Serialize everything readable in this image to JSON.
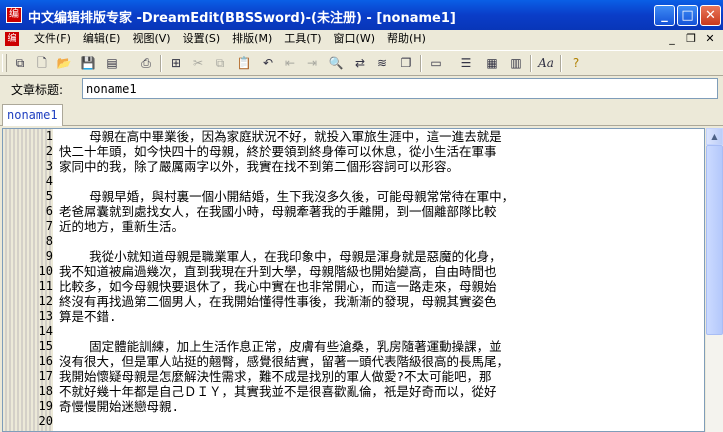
{
  "window": {
    "title": "中文编辑排版专家 -DreamEdit(BBSSword)-(未注册) - [noname1]"
  },
  "menu": [
    "文件(F)",
    "编辑(E)",
    "视图(V)",
    "设置(S)",
    "排版(M)",
    "工具(T)",
    "窗口(W)",
    "帮助(H)"
  ],
  "toolbar_icons": [
    "new-icon",
    "open-icon",
    "save-icon",
    "copy-format-icon",
    "print-icon",
    "paste-special-icon",
    "cut-icon",
    "copy-icon",
    "paste-icon",
    "undo-icon",
    "outdent-icon",
    "indent-icon",
    "find-icon",
    "replace-icon",
    "find-next-icon",
    "copy-doc-icon",
    "view-icon",
    "format-icon",
    "layout-icon",
    "columns-icon",
    "font-icon",
    "help-icon"
  ],
  "article_title": {
    "label": "文章标题:",
    "value": "noname1"
  },
  "tab": {
    "label": "noname1"
  },
  "lines": [
    {
      "n": "1",
      "t": "    母親在高中畢業後，因為家庭狀況不好，就投入軍旅生涯中，這一進去就是"
    },
    {
      "n": "2",
      "t": "快二十年頭，如今快四十的母親，終於要領到終身俸可以休息，從小生活在軍事"
    },
    {
      "n": "3",
      "t": "家同中的我，除了嚴厲兩字以外，我實在找不到第二個形容詞可以形容。"
    },
    {
      "n": "4",
      "t": ""
    },
    {
      "n": "5",
      "t": "    母親早婚，與村裏一個小開結婚，生下我沒多久後，可能母親常常待在軍中，"
    },
    {
      "n": "6",
      "t": "老爸屌囊就到處找女人，在我國小時，母親牽著我的手離開，到一個離部隊比較"
    },
    {
      "n": "7",
      "t": "近的地方，重新生活。"
    },
    {
      "n": "8",
      "t": ""
    },
    {
      "n": "9",
      "t": "    我從小就知道母親是職業軍人，在我印象中，母親是渾身就是惡魔的化身，"
    },
    {
      "n": "10",
      "t": "我不知道被扁過幾次，直到我現在升到大學，母親階級也開始變高，自由時間也"
    },
    {
      "n": "11",
      "t": "比較多，如今母親快要退休了，我心中實在也非常開心，而這一路走來，母親始"
    },
    {
      "n": "12",
      "t": "終沒有再找過第二個男人，在我開始懂得性事後，我漸漸的發現，母親其實姿色"
    },
    {
      "n": "13",
      "t": "算是不錯."
    },
    {
      "n": "14",
      "t": ""
    },
    {
      "n": "15",
      "t": "    固定體能訓練，加上生活作息正常，皮膚有些滄桑，乳房隨著運動操課，並"
    },
    {
      "n": "16",
      "t": "沒有很大，但是軍人站挺的翹臀，感覺很結實，留著一頭代表階級很高的長馬尾，"
    },
    {
      "n": "17",
      "t": "我開始懷疑母親是怎麼解決性需求，難不成是找別的軍人做愛?不太可能吧，那"
    },
    {
      "n": "18",
      "t": "不就好幾十年都是自己ＤＩＹ，其實我並不是很喜歡亂倫，祇是好奇而以，從好"
    },
    {
      "n": "19",
      "t": "奇慢慢開始迷戀母親."
    },
    {
      "n": "20",
      "t": ""
    }
  ]
}
